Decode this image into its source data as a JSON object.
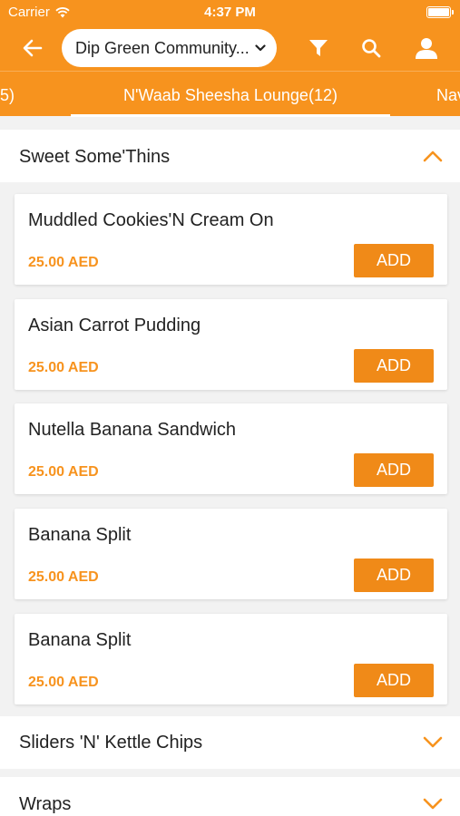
{
  "status_bar": {
    "carrier": "Carrier",
    "time": "4:37 PM"
  },
  "header": {
    "location": "Dip Green Community..."
  },
  "tabs": {
    "prev": "5)",
    "active": "N'Waab Sheesha Lounge(12)",
    "next": "Nav"
  },
  "sections": [
    {
      "title": "Sweet Some'Thins",
      "expanded": true,
      "items": [
        {
          "name": "Muddled Cookies'N Cream On",
          "price": "25.00 AED",
          "add_label": "ADD"
        },
        {
          "name": "Asian Carrot Pudding",
          "price": "25.00 AED",
          "add_label": "ADD"
        },
        {
          "name": "Nutella Banana Sandwich",
          "price": "25.00 AED",
          "add_label": "ADD"
        },
        {
          "name": "Banana Split",
          "price": "25.00 AED",
          "add_label": "ADD"
        },
        {
          "name": "Banana Split",
          "price": "25.00 AED",
          "add_label": "ADD"
        }
      ]
    },
    {
      "title": "Sliders 'N' Kettle Chips",
      "expanded": false
    },
    {
      "title": "Wraps",
      "expanded": false
    }
  ],
  "colors": {
    "accent": "#f7931e",
    "button": "#f08a18",
    "background": "#f2f2f2"
  }
}
